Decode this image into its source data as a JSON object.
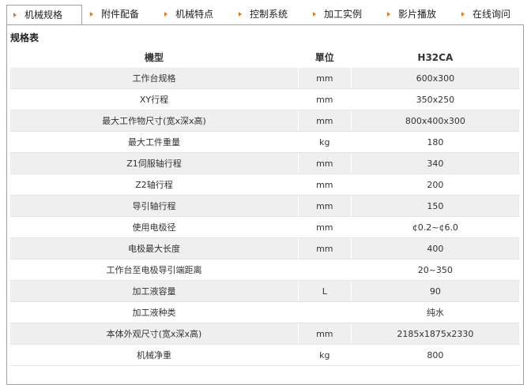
{
  "tabs": [
    {
      "label": "机械规格",
      "active": true
    },
    {
      "label": "附件配备",
      "active": false
    },
    {
      "label": "机械特点",
      "active": false
    },
    {
      "label": "控制系统",
      "active": false
    },
    {
      "label": "加工实例",
      "active": false
    },
    {
      "label": "影片播放",
      "active": false
    },
    {
      "label": "在线询问",
      "active": false
    }
  ],
  "section_title": "规格表",
  "table": {
    "headers": [
      "機型",
      "單位",
      "H32CA"
    ],
    "rows": [
      [
        "工作台规格",
        "mm",
        "600x300"
      ],
      [
        "XY行程",
        "mm",
        "350x250"
      ],
      [
        "最大工作物尺寸(宽x深x高)",
        "mm",
        "800x400x300"
      ],
      [
        "最大工件重量",
        "kg",
        "180"
      ],
      [
        "Z1伺服轴行程",
        "mm",
        "340"
      ],
      [
        "Z2轴行程",
        "mm",
        "200"
      ],
      [
        "导引轴行程",
        "mm",
        "150"
      ],
      [
        "使用电极径",
        "mm",
        "¢0.2~¢6.0"
      ],
      [
        "电极最大长度",
        "mm",
        "400"
      ],
      [
        "工作台至电极导引端距离",
        "",
        "20~350"
      ],
      [
        "加工液容量",
        "L",
        "90"
      ],
      [
        "加工液种类",
        "",
        "纯水"
      ],
      [
        "本体外观尺寸(宽x深x高)",
        "mm",
        "2185x1875x2330"
      ],
      [
        "机械净重",
        "kg",
        "800"
      ]
    ]
  }
}
